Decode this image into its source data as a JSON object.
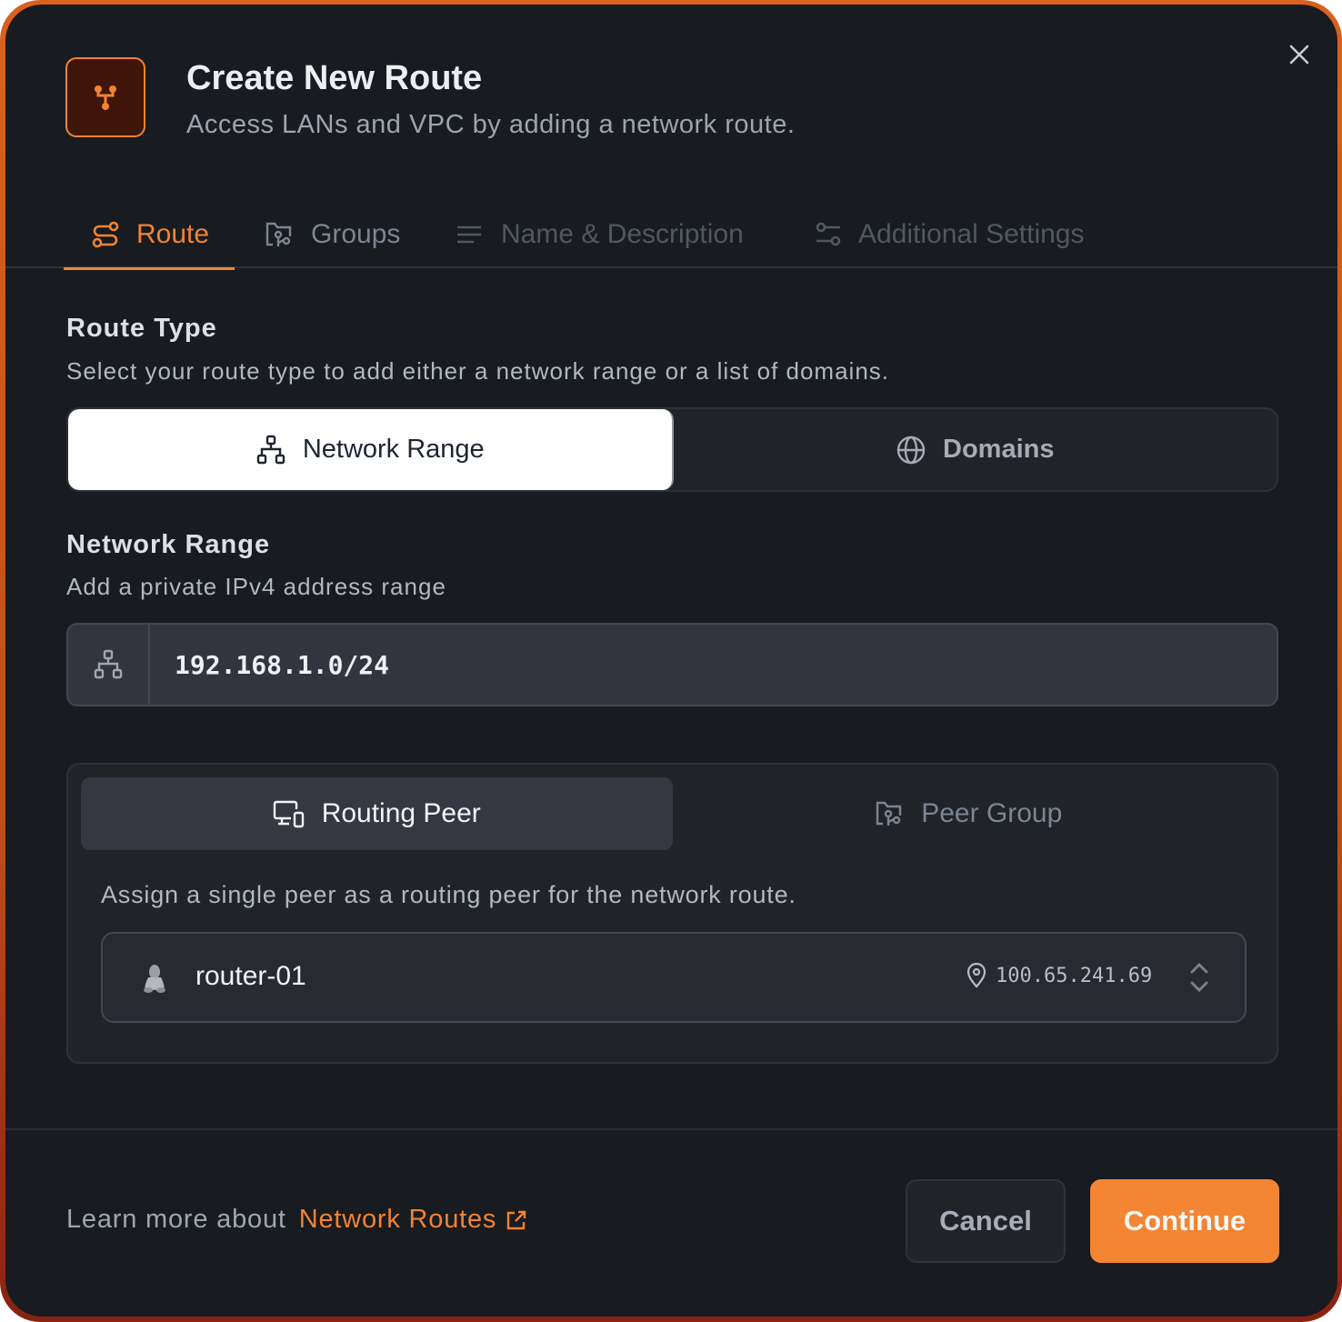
{
  "dialog": {
    "title": "Create New Route",
    "subtitle": "Access LANs and VPC by adding a network route.",
    "header_icon": "route-fork-icon",
    "close_icon": "close-icon"
  },
  "tabs": [
    {
      "label": "Route",
      "icon": "route-icon",
      "active": true
    },
    {
      "label": "Groups",
      "icon": "folder-group-icon",
      "active": false
    },
    {
      "label": "Name & Description",
      "icon": "text-lines-icon",
      "active": false
    },
    {
      "label": "Additional Settings",
      "icon": "settings-sliders-icon",
      "active": false
    }
  ],
  "route_type": {
    "label": "Route Type",
    "description": "Select your route type to add either a network range or a list of domains.",
    "options": [
      {
        "label": "Network Range",
        "icon": "network-icon",
        "selected": true
      },
      {
        "label": "Domains",
        "icon": "globe-icon",
        "selected": false
      }
    ]
  },
  "network_range": {
    "label": "Network Range",
    "description": "Add a private IPv4 address range",
    "value": "192.168.1.0/24",
    "icon": "network-icon"
  },
  "peer_section": {
    "tabs": [
      {
        "label": "Routing Peer",
        "icon": "devices-icon",
        "active": true
      },
      {
        "label": "Peer Group",
        "icon": "folder-group-icon",
        "active": false
      }
    ],
    "description": "Assign a single peer as a routing peer for the network route.",
    "selected_peer": {
      "name": "router-01",
      "os_icon": "linux-tux-icon",
      "ip": "100.65.241.69",
      "ip_icon": "map-pin-icon"
    }
  },
  "footer": {
    "learn_prefix": "Learn more about",
    "learn_link": "Network Routes",
    "cancel_label": "Cancel",
    "continue_label": "Continue"
  },
  "colors": {
    "accent": "#f38332",
    "background": "#181b1f",
    "border_frame": "#d8621c"
  }
}
